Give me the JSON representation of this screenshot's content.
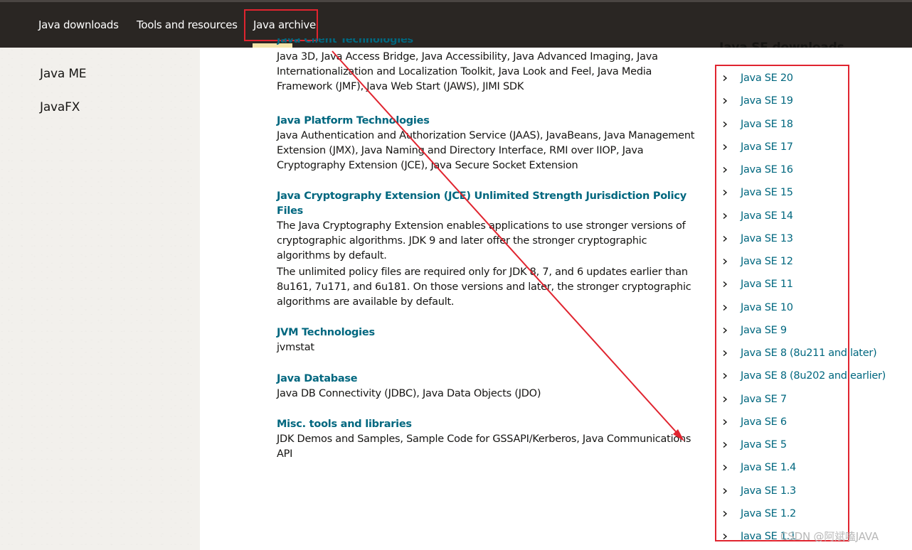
{
  "nav": {
    "items": [
      {
        "label": "Java downloads"
      },
      {
        "label": "Tools and resources"
      },
      {
        "label": "Java archive"
      }
    ]
  },
  "sidebar": {
    "items": [
      {
        "label": "Java ME"
      },
      {
        "label": "JavaFX"
      }
    ]
  },
  "main": {
    "sections": [
      {
        "title": "Java Client Technologies",
        "body": "Java 3D, Java Access Bridge, Java Accessibility, Java Advanced Imaging, Java Internationalization and Localization Toolkit, Java Look and Feel, Java Media Framework (JMF), Java Web Start (JAWS), JIMI SDK"
      },
      {
        "title": "Java Platform Technologies",
        "body": "Java Authentication and Authorization Service (JAAS), JavaBeans, Java Management Extension (JMX), Java Naming and Directory Interface, RMI over IIOP, Java Cryptography Extension (JCE), Java Secure Socket Extension"
      },
      {
        "title": "Java Cryptography Extension (JCE) Unlimited Strength Jurisdiction Policy Files",
        "body": "The Java Cryptography Extension enables applications to use stronger versions of cryptographic algorithms. JDK 9 and later offer the stronger cryptographic algorithms by default."
      },
      {
        "title": "",
        "body": "The unlimited policy files are required only for JDK 8, 7, and 6 updates earlier than 8u161, 7u171, and 6u181. On those versions and later, the stronger cryptographic algorithms are available by default."
      },
      {
        "title": "JVM Technologies",
        "body": "jvmstat"
      },
      {
        "title": "Java Database",
        "body": "Java DB Connectivity (JDBC), Java Data Objects (JDO)"
      },
      {
        "title": "Misc. tools and libraries",
        "body": "JDK Demos and Samples, Sample Code for GSSAPI/Kerberos, Java Communications API"
      }
    ]
  },
  "right": {
    "title": "Java SE downloads",
    "items": [
      {
        "label": "Java SE 20"
      },
      {
        "label": "Java SE 19"
      },
      {
        "label": "Java SE 18"
      },
      {
        "label": "Java SE 17"
      },
      {
        "label": "Java SE 16"
      },
      {
        "label": "Java SE 15"
      },
      {
        "label": "Java SE 14"
      },
      {
        "label": "Java SE 13"
      },
      {
        "label": "Java SE 12"
      },
      {
        "label": "Java SE 11"
      },
      {
        "label": "Java SE 10"
      },
      {
        "label": "Java SE 9"
      },
      {
        "label": "Java SE 8 (8u211 and later)"
      },
      {
        "label": "Java SE 8 (8u202 and earlier)"
      },
      {
        "label": "Java SE 7"
      },
      {
        "label": "Java SE 6"
      },
      {
        "label": "Java SE 5"
      },
      {
        "label": "Java SE 1.4"
      },
      {
        "label": "Java SE 1.3"
      },
      {
        "label": "Java SE 1.2"
      },
      {
        "label": "Java SE 1.1"
      }
    ]
  },
  "watermark": "CSDN @阿斌嗑JAVA",
  "colors": {
    "nav_bg": "#2a2623",
    "link": "#00677f",
    "annotation_red": "#e0242f",
    "sidebar_bg": "#f2f0ec"
  }
}
